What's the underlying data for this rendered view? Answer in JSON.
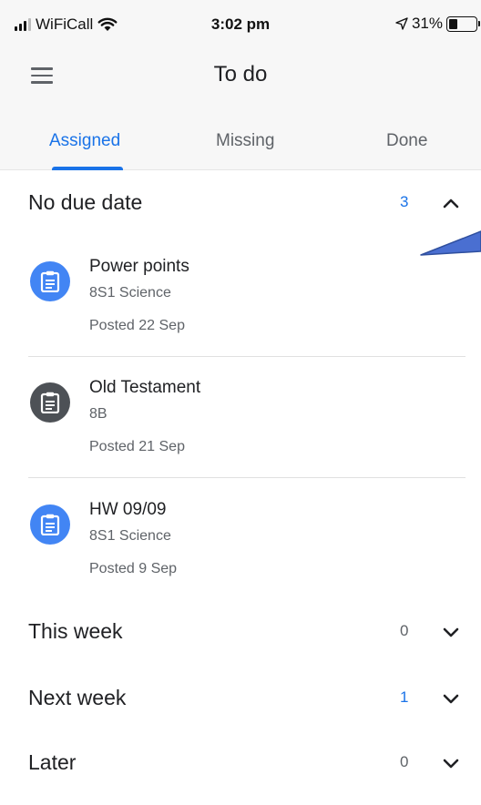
{
  "status_bar": {
    "carrier": "WiFiCall",
    "time": "3:02 pm",
    "battery": "31%",
    "battery_level": 0.31,
    "icons": [
      "signal-icon",
      "wifi-icon",
      "location-arrow-icon",
      "battery-icon"
    ]
  },
  "app_bar": {
    "title": "To do",
    "menu_icon": "menu-icon"
  },
  "tabs": [
    {
      "label": "Assigned",
      "active": true
    },
    {
      "label": "Missing",
      "active": false
    },
    {
      "label": "Done",
      "active": false
    }
  ],
  "sections": {
    "no_due_date": {
      "title": "No due date",
      "count": "3",
      "expanded": true,
      "items": [
        {
          "title": "Power points",
          "class": "8S1 Science",
          "posted": "Posted 22 Sep",
          "icon": "assignment-icon",
          "icon_color": "#4285f4"
        },
        {
          "title": "Old Testament",
          "class": "8B",
          "posted": "Posted 21 Sep",
          "icon": "assignment-icon",
          "icon_color": "#4d5156"
        },
        {
          "title": "HW 09/09",
          "class": "8S1 Science",
          "posted": "Posted 9 Sep",
          "icon": "assignment-icon",
          "icon_color": "#4285f4"
        }
      ]
    },
    "this_week": {
      "title": "This week",
      "count": "0",
      "expanded": false
    },
    "next_week": {
      "title": "Next week",
      "count": "1",
      "expanded": false
    },
    "later": {
      "title": "Later",
      "count": "0",
      "expanded": false
    }
  },
  "colors": {
    "accent": "#1a73e8",
    "background": "#ffffff",
    "header_background": "#f7f7f7",
    "annotation_fill": "#4a6fd1"
  }
}
